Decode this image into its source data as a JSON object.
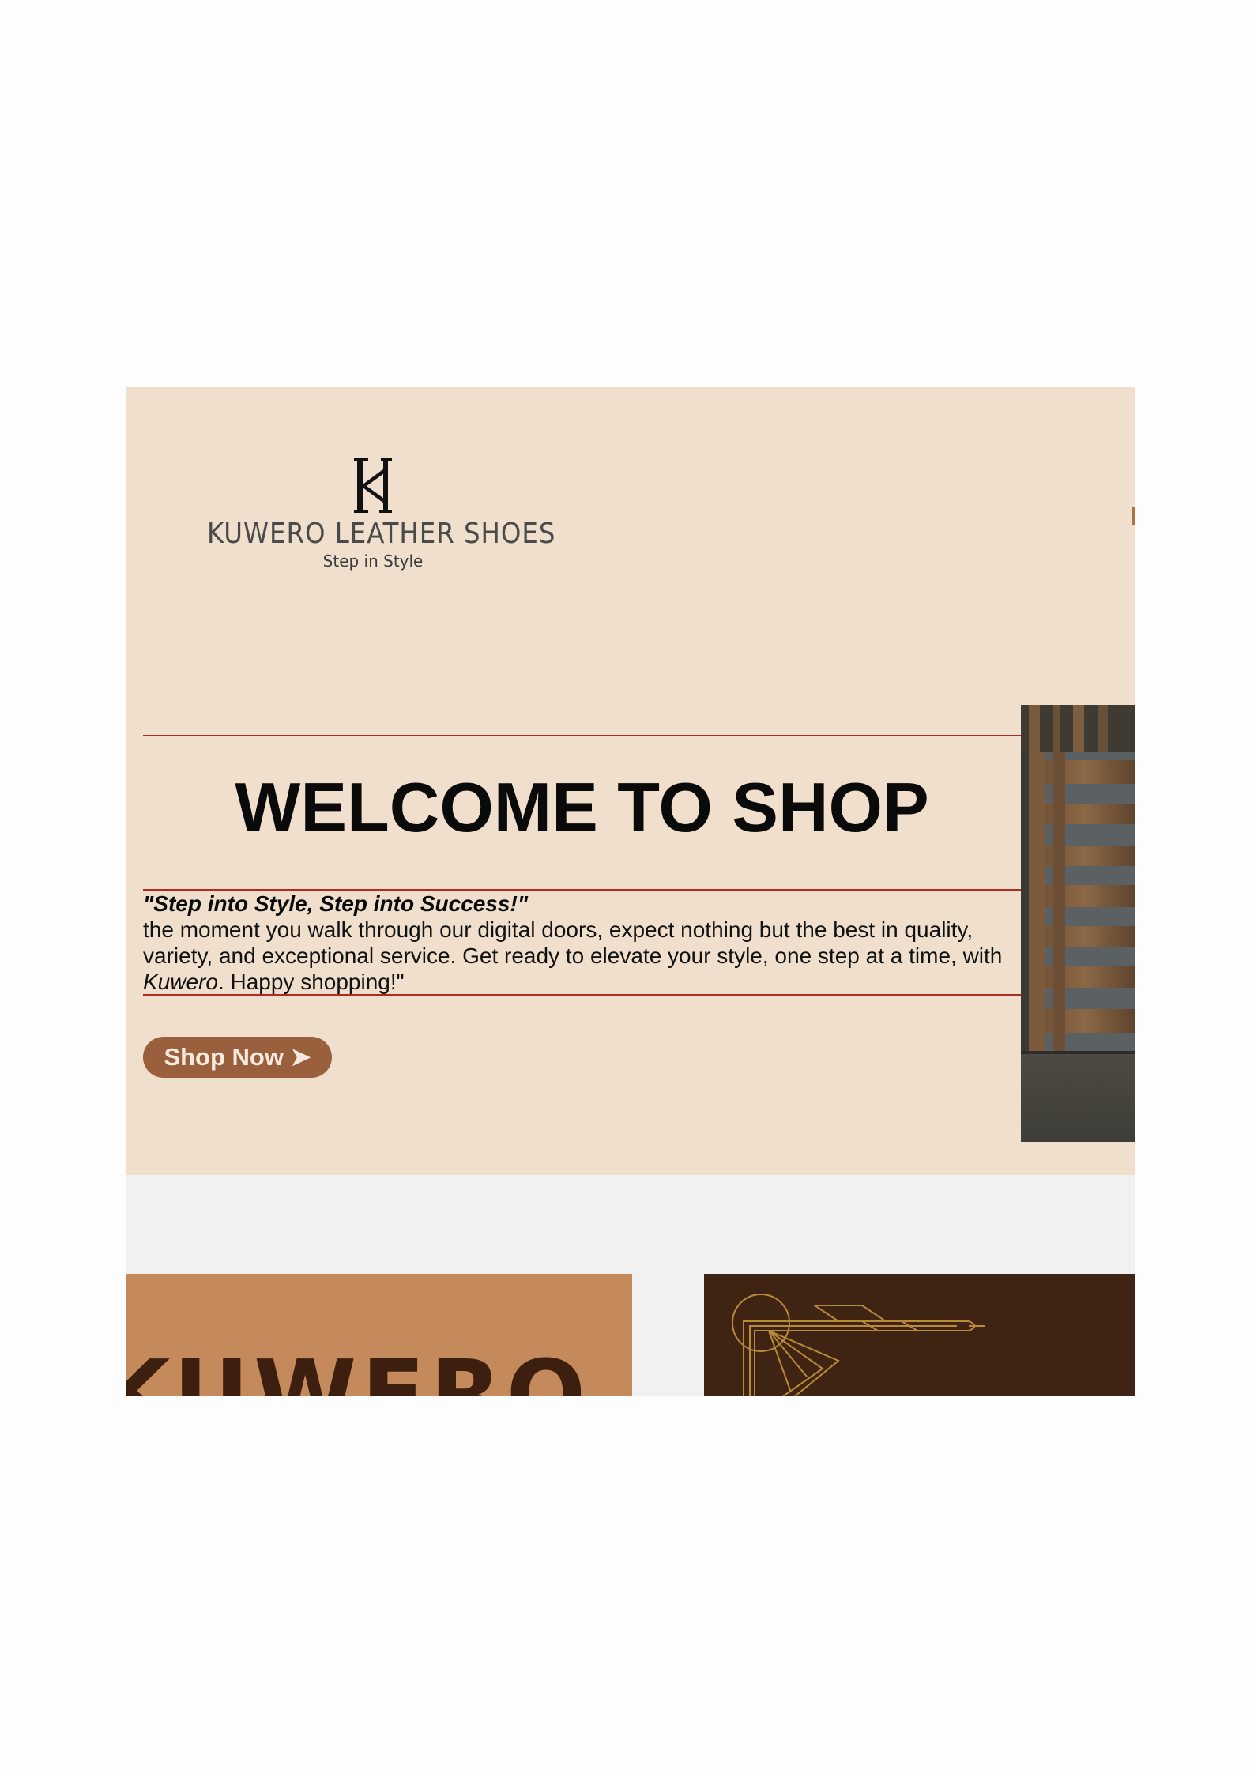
{
  "brand": {
    "name": "KUWERO LEATHER SHOES",
    "tagline": "Step in Style",
    "monogram": "K"
  },
  "hero": {
    "heading": "WELCOME TO SHOP",
    "slogan": "\"Step into Style, Step into Success!\"",
    "body_part1": "the moment you walk through our digital doors, expect nothing but the best in quality, variety, and exceptional service. Get ready to elevate your style, one step at a time, with ",
    "body_brand": "Kuwero",
    "body_part2": ". Happy shopping!\"",
    "cta_label": "Shop Now ➤"
  },
  "cards": {
    "left_text": "KUWERO"
  },
  "colors": {
    "hero_bg": "#f0dfcc",
    "rule": "#b02a24",
    "button": "#9a5f3c",
    "card_left": "#c58a5c",
    "card_right": "#3f2414",
    "gold_line": "#b98a3a"
  }
}
